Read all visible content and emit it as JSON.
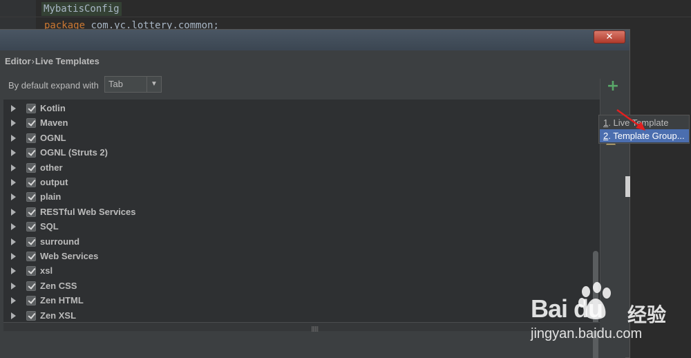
{
  "editor": {
    "line1": "MybatisConfig",
    "line2_keyword": "package",
    "line2_rest": " com.yc.lottery.common;"
  },
  "dialog": {
    "close_symbol": "✕",
    "breadcrumb": {
      "parent": "Editor",
      "separator": "›",
      "current": "Live Templates"
    },
    "expand_label": "By default expand with",
    "expand_value": "Tab"
  },
  "tree": {
    "items": [
      {
        "label": "Kotlin",
        "checked": true
      },
      {
        "label": "Maven",
        "checked": true
      },
      {
        "label": "OGNL",
        "checked": true
      },
      {
        "label": "OGNL (Struts 2)",
        "checked": true
      },
      {
        "label": "other",
        "checked": true
      },
      {
        "label": "output",
        "checked": true
      },
      {
        "label": "plain",
        "checked": true
      },
      {
        "label": "RESTful Web Services",
        "checked": true
      },
      {
        "label": "SQL",
        "checked": true
      },
      {
        "label": "surround",
        "checked": true
      },
      {
        "label": "Web Services",
        "checked": true
      },
      {
        "label": "xsl",
        "checked": true
      },
      {
        "label": "Zen CSS",
        "checked": true
      },
      {
        "label": "Zen HTML",
        "checked": true
      },
      {
        "label": "Zen XSL",
        "checked": true
      }
    ]
  },
  "toolbar": {
    "add_symbol": "+"
  },
  "popup": {
    "items": [
      {
        "mnemonic": "1",
        "label": ". Live Template",
        "selected": false
      },
      {
        "mnemonic": "2",
        "label": ". Template Group...",
        "selected": true
      }
    ]
  },
  "watermark": {
    "brand": "Bai du",
    "brand_cn": "经验",
    "url": "jingyan.baidu.com"
  },
  "colors": {
    "accent_selected": "#4b6eaf",
    "add_green": "#59a869",
    "arrow_red": "#e02020"
  }
}
